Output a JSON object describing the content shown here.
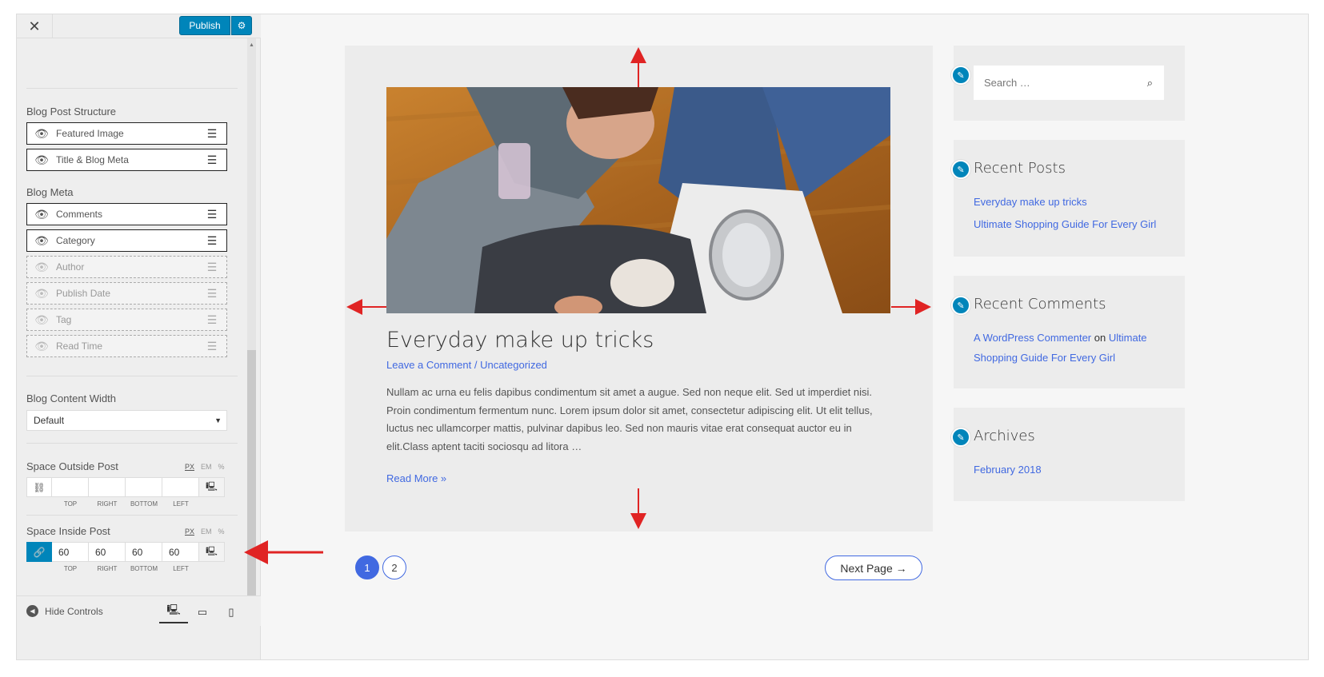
{
  "panel": {
    "close_icon": "close-icon",
    "publish_label": "Publish",
    "blog_post_structure_title": "Blog Post Structure",
    "structure_items": [
      {
        "label": "Featured Image",
        "visible": true
      },
      {
        "label": "Title & Blog Meta",
        "visible": true
      }
    ],
    "blog_meta_title": "Blog Meta",
    "meta_items": [
      {
        "label": "Comments",
        "visible": true
      },
      {
        "label": "Category",
        "visible": true
      },
      {
        "label": "Author",
        "visible": false
      },
      {
        "label": "Publish Date",
        "visible": false
      },
      {
        "label": "Tag",
        "visible": false
      },
      {
        "label": "Read Time",
        "visible": false
      }
    ],
    "content_width_title": "Blog Content Width",
    "content_width_value": "Default",
    "units": [
      "PX",
      "EM",
      "%"
    ],
    "space_outside_title": "Space Outside Post",
    "space_outside_values": {
      "top": "",
      "right": "",
      "bottom": "",
      "left": ""
    },
    "space_inside_title": "Space Inside Post",
    "space_inside_values": {
      "top": "60",
      "right": "60",
      "bottom": "60",
      "left": "60"
    },
    "side_labels": {
      "top": "TOP",
      "right": "RIGHT",
      "bottom": "BOTTOM",
      "left": "LEFT"
    },
    "hide_controls_label": "Hide Controls",
    "accent_color": "#0085ba"
  },
  "post": {
    "title": "Everyday make up tricks",
    "meta_comment": "Leave a Comment",
    "meta_separator": " / ",
    "meta_category": "Uncategorized",
    "excerpt": "Nullam ac urna eu felis dapibus condimentum sit amet a augue. Sed non neque elit. Sed ut imperdiet nisi. Proin condimentum fermentum nunc. Lorem ipsum dolor sit amet, consectetur adipiscing elit. Ut elit tellus, luctus nec ullamcorper mattis, pulvinar dapibus leo. Sed non mauris vitae erat consequat auctor eu in elit.Class aptent taciti sociosqu ad litora …",
    "read_more": "Read More »",
    "link_color": "#4169e1"
  },
  "pagination": {
    "pages": [
      "1",
      "2"
    ],
    "current": "1",
    "next_label": "Next Page →"
  },
  "sidebar": {
    "search_placeholder": "Search …",
    "recent_posts_title": "Recent Posts",
    "recent_posts": [
      "Everyday make up tricks",
      "Ultimate Shopping Guide For Every Girl"
    ],
    "recent_comments_title": "Recent Comments",
    "comment_author": "A WordPress Commenter",
    "comment_on": "on",
    "comment_post_line1": "Ultimate",
    "comment_post_line2": "Shopping Guide For Every Girl",
    "archives_title": "Archives",
    "archives": [
      "February 2018"
    ]
  },
  "annotation_color": "#e02424"
}
